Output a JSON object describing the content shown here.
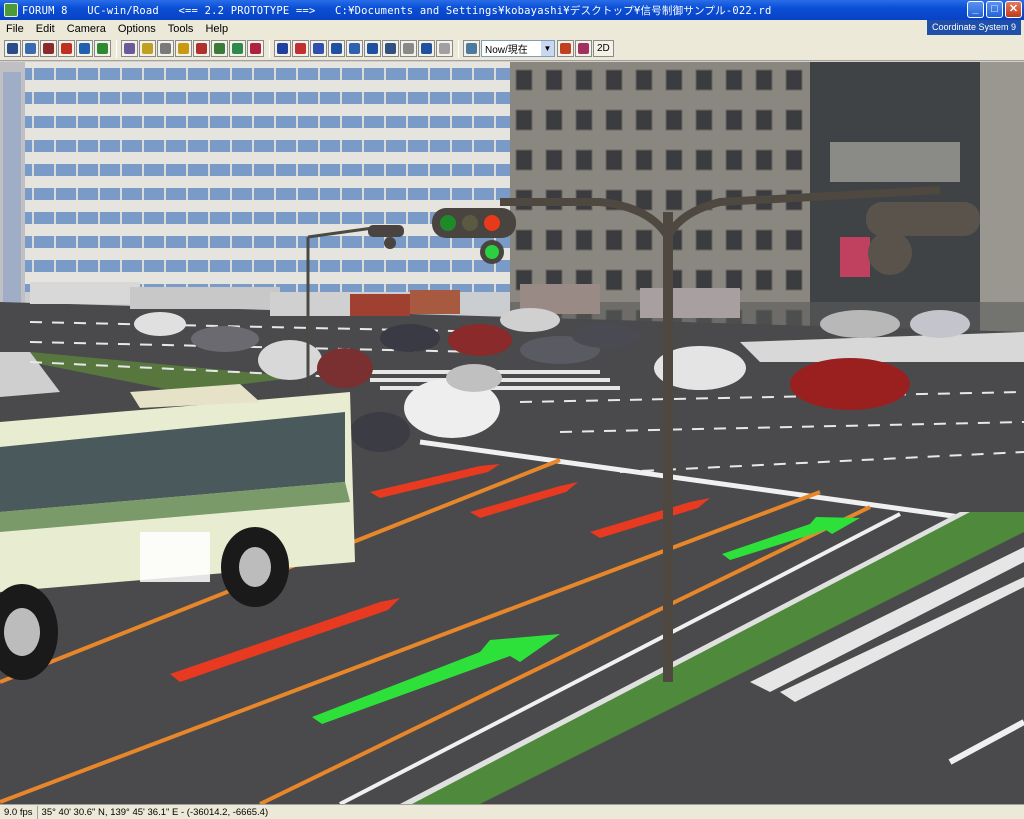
{
  "window": {
    "title": "FORUM 8   UC-win/Road   <== 2.2 PROTOTYPE ==>   C:¥Documents and Settings¥kobayashi¥デスクトップ¥信号制御サンプル-022.rd",
    "controls": [
      "_",
      "□",
      "✕"
    ]
  },
  "menu": [
    "File",
    "Edit",
    "Camera",
    "Options",
    "Tools",
    "Help"
  ],
  "coordinate_system": "Coordinate System 9",
  "toolbar": {
    "time_select_value": "Now/現在",
    "mode_2d_label": "2D",
    "icons": [
      {
        "name": "road-edit-icon",
        "color": "#2b4b8a"
      },
      {
        "name": "road-section-icon",
        "color": "#3a6ab0"
      },
      {
        "name": "car-icon",
        "color": "#8a2a2a"
      },
      {
        "name": "person-icon",
        "color": "#c03020"
      },
      {
        "name": "pedestrian-icon",
        "color": "#2060b0"
      },
      {
        "name": "tree-icon",
        "color": "#2e8a30"
      },
      {
        "name": "building-icon",
        "color": "#6a5a9a"
      },
      {
        "name": "terrain-icon",
        "color": "#c0a020"
      },
      {
        "name": "tunnel-icon",
        "color": "#7a7a7a"
      },
      {
        "name": "sign-icon",
        "color": "#c89a10"
      },
      {
        "name": "vehicle-icon",
        "color": "#b03030"
      },
      {
        "name": "route-icon",
        "color": "#3a7a3a"
      },
      {
        "name": "scenario-icon",
        "color": "#2d8a4a"
      },
      {
        "name": "model-icon",
        "color": "#b02040"
      },
      {
        "name": "rotate-icon",
        "color": "#2040a0"
      },
      {
        "name": "anchor-icon",
        "color": "#c03030"
      },
      {
        "name": "move-icon",
        "color": "#3050b0"
      },
      {
        "name": "pan-icon",
        "color": "#2050a0"
      },
      {
        "name": "zoom-icon",
        "color": "#3060b0"
      },
      {
        "name": "globe-icon",
        "color": "#2050a0"
      },
      {
        "name": "walk-icon",
        "color": "#305080"
      },
      {
        "name": "pause-icon",
        "color": "#8a8a8a"
      },
      {
        "name": "drive-icon",
        "color": "#2050a0"
      },
      {
        "name": "fly-icon",
        "color": "#a0a0a0"
      },
      {
        "name": "view-icon",
        "color": "#4a7aa0"
      },
      {
        "name": "weather-icon",
        "color": "#c04020"
      },
      {
        "name": "flag-icon",
        "color": "#a03060"
      }
    ]
  },
  "status": {
    "fps": "9.0 fps",
    "position": "35°  40' 30.6\" N, 139°  45' 36.1\" E  -  (-36014.2, -6665.4)"
  },
  "scene_colors": {
    "sky": "#c8d0d8",
    "road": "#4a4a4c",
    "lane_orange": "#e8862a",
    "arrow_red": "#e83a20",
    "arrow_green": "#2ee03a",
    "median": "#4f8a3c",
    "bus_body": "#e8ecd0",
    "bus_stripe": "#7a9a6a"
  }
}
